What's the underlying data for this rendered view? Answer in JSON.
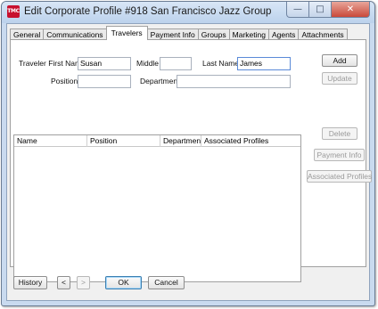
{
  "window": {
    "icon_label": "TMC",
    "title": "Edit Corporate Profile #918 San Francisco Jazz Group",
    "minimize_glyph": "—",
    "maximize_glyph": "□",
    "close_glyph": "✕"
  },
  "tabs": [
    {
      "label": "General"
    },
    {
      "label": "Communications"
    },
    {
      "label": "Travelers",
      "active": true
    },
    {
      "label": "Payment Info"
    },
    {
      "label": "Groups"
    },
    {
      "label": "Marketing"
    },
    {
      "label": "Agents"
    },
    {
      "label": "Attachments"
    }
  ],
  "form": {
    "first_name_label": "Traveler First Name",
    "first_name_value": "Susan",
    "middle_label": "Middle",
    "middle_value": "",
    "last_name_label": "Last Name",
    "last_name_value": "James",
    "position_label": "Position",
    "position_value": "",
    "department_label": "Department",
    "department_value": ""
  },
  "side_buttons": {
    "add": "Add",
    "update": "Update",
    "delete": "Delete",
    "payment_info": "Payment Info",
    "associated_profiles": "Associated Profiles"
  },
  "grid": {
    "columns": [
      "Name",
      "Position",
      "Department",
      "Associated Profiles"
    ],
    "rows": []
  },
  "bottom": {
    "history": "History",
    "prev_glyph": "<",
    "next_glyph": ">",
    "ok": "OK",
    "cancel": "Cancel"
  }
}
